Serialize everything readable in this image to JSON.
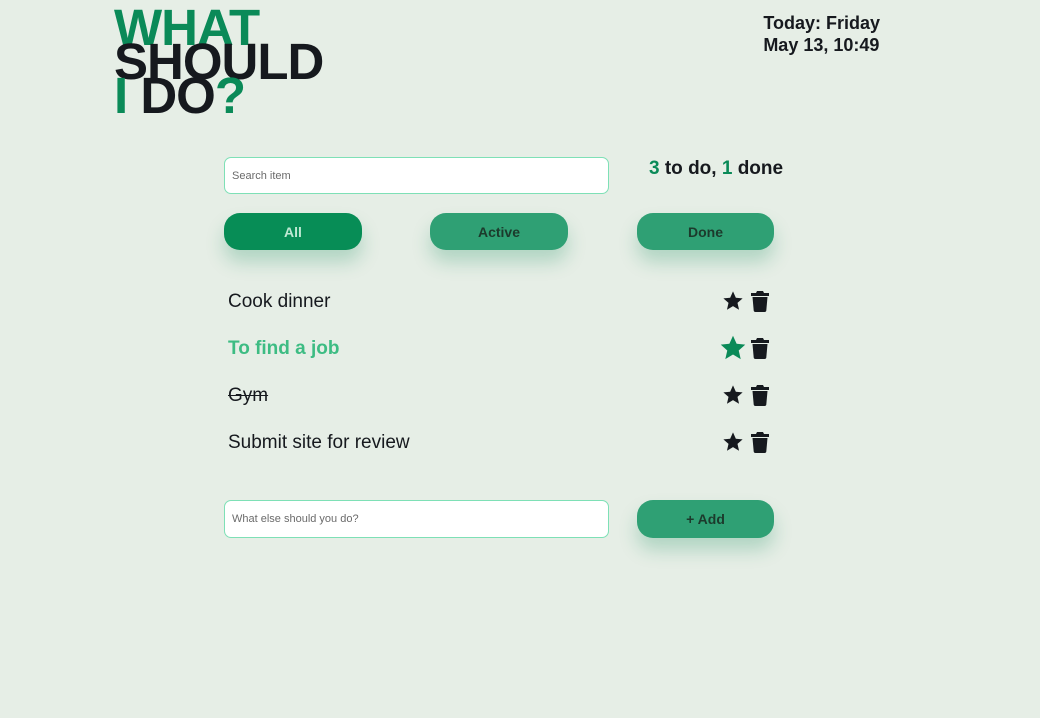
{
  "logo": {
    "line1": "WHAT",
    "line2": "SHOULD",
    "line3a": "I DO",
    "line3b": "?"
  },
  "date": {
    "line1": "Today: Friday",
    "line2": "May 13, 10:49"
  },
  "search": {
    "placeholder": "Search item",
    "value": ""
  },
  "counts": {
    "todo": "3",
    "todo_label": " to do, ",
    "done": "1",
    "done_label": " done"
  },
  "filters": [
    {
      "label": "All",
      "selected": true
    },
    {
      "label": "Active",
      "selected": false
    },
    {
      "label": "Done",
      "selected": false
    }
  ],
  "todos": [
    {
      "label": "Cook dinner",
      "important": false,
      "done": false
    },
    {
      "label": "To find a job",
      "important": true,
      "done": false
    },
    {
      "label": "Gym",
      "important": false,
      "done": true
    },
    {
      "label": "Submit site for review",
      "important": false,
      "done": false
    }
  ],
  "icons": {
    "star": "star-icon",
    "trash": "trash-icon"
  },
  "add_form": {
    "placeholder": "What else should you do?",
    "value": "",
    "button_label": "+ Add"
  },
  "colors": {
    "accent": "#0a8a58",
    "button": "#2fa074",
    "button_selected": "#078d56",
    "important_text": "#3dbc83",
    "background": "#e6eee6"
  }
}
